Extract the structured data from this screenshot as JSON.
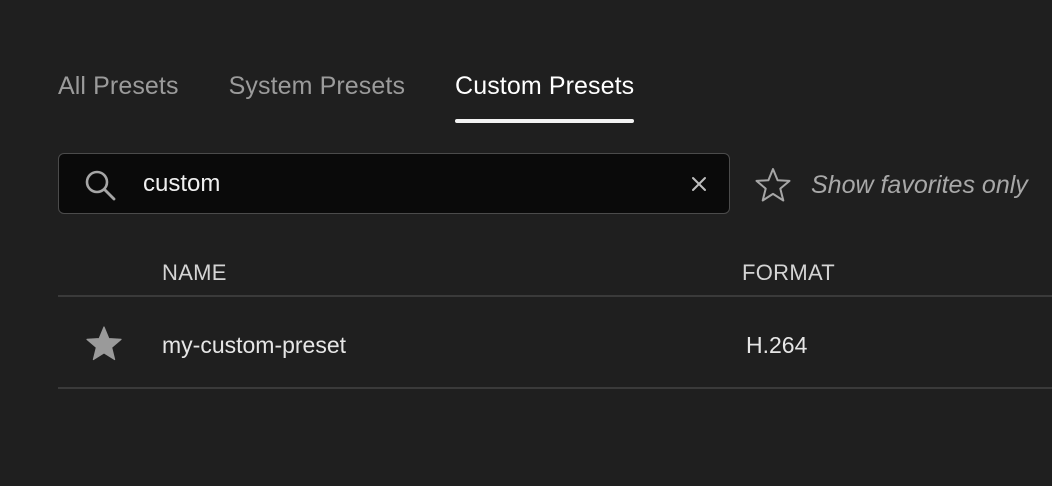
{
  "tabs": [
    {
      "label": "All Presets",
      "active": false
    },
    {
      "label": "System Presets",
      "active": false
    },
    {
      "label": "Custom Presets",
      "active": true
    }
  ],
  "search": {
    "value": "custom",
    "icon": "search-icon",
    "clear_icon": "close-icon"
  },
  "favorites": {
    "label": "Show favorites only",
    "icon": "star-outline-icon"
  },
  "table": {
    "columns": [
      "NAME",
      "FORMAT"
    ],
    "rows": [
      {
        "favorite_icon": "star-filled-icon",
        "name": "my-custom-preset",
        "format": "H.264"
      }
    ]
  },
  "colors": {
    "background": "#1f1f1f",
    "search_background": "#0a0a0a",
    "active_tab": "#ffffff",
    "inactive_tab": "#9b9b9b",
    "divider": "#3a3a3a"
  }
}
